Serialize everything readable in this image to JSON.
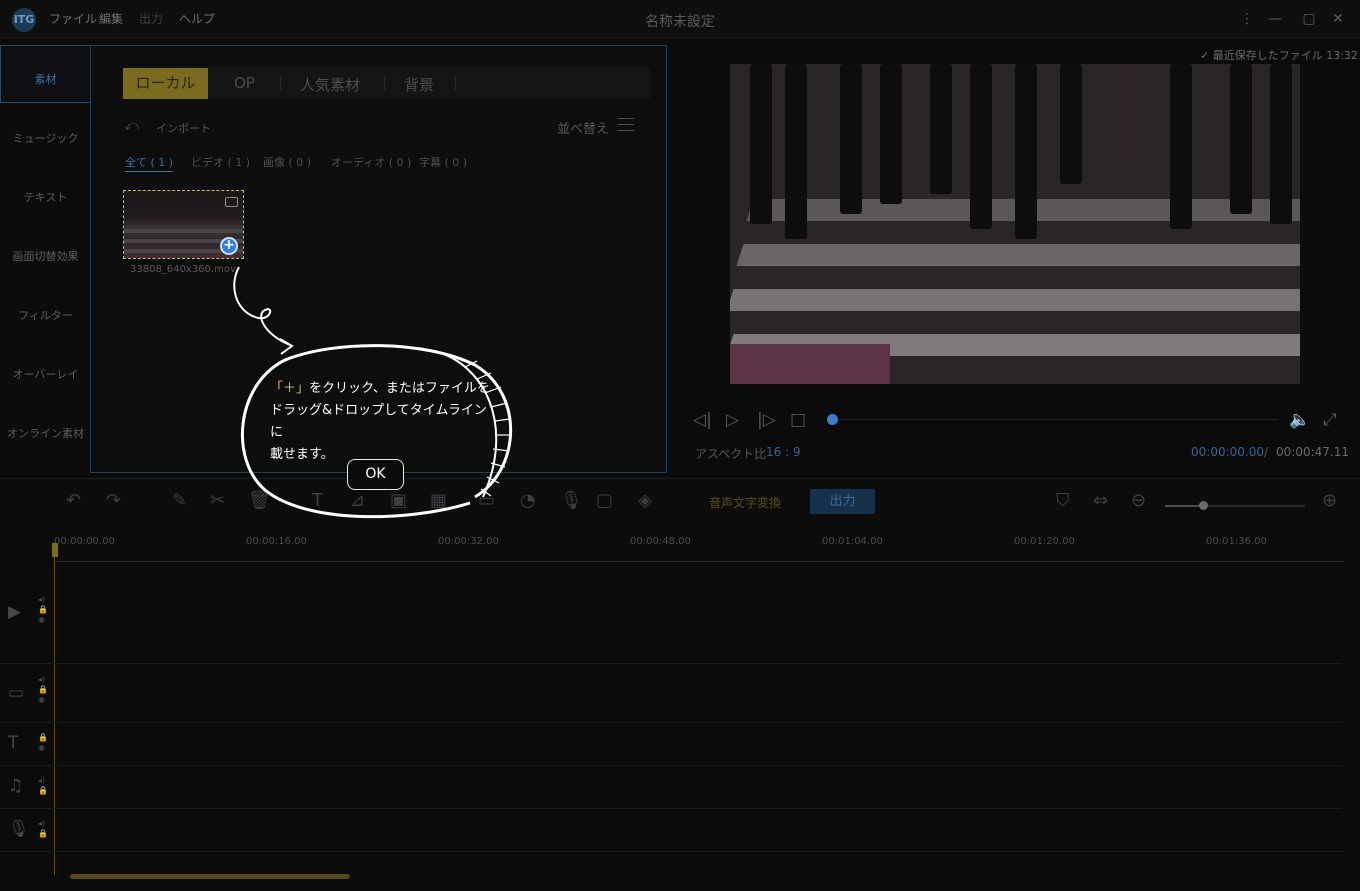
{
  "titlebar": {
    "logo": "ITG",
    "menus": [
      "ファイル",
      "編集",
      "出力",
      "ヘルプ"
    ],
    "title": "名称未設定",
    "controls": [
      "more-icon",
      "minimize-icon",
      "maximize-icon",
      "close-icon"
    ]
  },
  "categories": [
    "素材",
    "ミュージック",
    "テキスト",
    "画面切替効果",
    "フィルター",
    "オーバーレイ",
    "オンライン素材"
  ],
  "media": {
    "tabs": [
      "ローカル",
      "OP",
      "人気素材",
      "背景"
    ],
    "import_label": "インポート",
    "sort_label": "並べ替え",
    "filters": [
      "全て ( 1 )",
      "ビデオ ( 1 )",
      "画像 ( 0 )",
      "オーディオ ( 0 )",
      "字幕 ( 0 )"
    ],
    "items": [
      {
        "filename": "33808_640x360.mov"
      }
    ]
  },
  "preview": {
    "saved_label": "✓ 最近保存したファイル 13:32",
    "aspect_label": "アスペクト比",
    "aspect_value": "16 : 9",
    "time_current": "00:00:00.00",
    "time_separator": "/",
    "time_total": "00:00:47.11",
    "progress": 0
  },
  "toolbar": {
    "speech_to_text": "音声文字変換",
    "export": "出力",
    "zoom_level": 0.27
  },
  "timeline": {
    "ticks": [
      "00:00:00.00",
      "00:00:16.00",
      "00:00:32.00",
      "00:00:48.00",
      "00:01:04.00",
      "00:01:20.00",
      "00:01:36.00"
    ]
  },
  "tooltip": {
    "plus": "「＋」",
    "line1": "をクリック、またはファイルを",
    "line2": "ドラッグ&ドロップしてタイムラインに",
    "line3": "載せます。",
    "ok": "OK"
  },
  "colors": {
    "accent": "#7a6b1e",
    "blue": "#2f7ee3",
    "tooltip_plus": "#e8c54a"
  }
}
